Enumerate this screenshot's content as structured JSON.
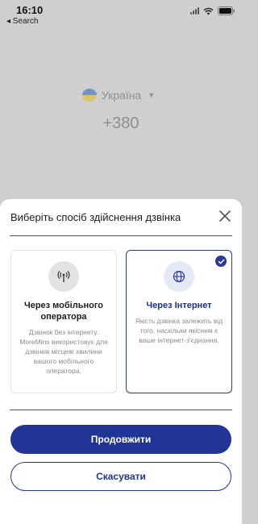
{
  "status_bar": {
    "time": "16:10",
    "back_label": "◂ Search"
  },
  "background": {
    "country": "Україна",
    "dial_code": "+380"
  },
  "sheet": {
    "title": "Виберіть спосіб здійснення дзвінка",
    "options": [
      {
        "title": "Через мобільного оператора",
        "description": "Дзвінок без інтернету. MoreMins використовує для дзвінків місцеві хвилини вашого мобільного оператора.",
        "icon": "antenna-icon",
        "selected": false
      },
      {
        "title": "Через Інтернет",
        "description": "Якість дзвінка залежить від того, наскільки якісним є ваше інтернет-з'єднання.",
        "icon": "globe-icon",
        "selected": true
      }
    ],
    "continue_label": "Продовжити",
    "cancel_label": "Скасувати"
  },
  "colors": {
    "accent": "#223596",
    "overlay": "#cfcfcf",
    "flag_blue": "#6f93c7",
    "flag_yellow": "#d7c56a"
  }
}
